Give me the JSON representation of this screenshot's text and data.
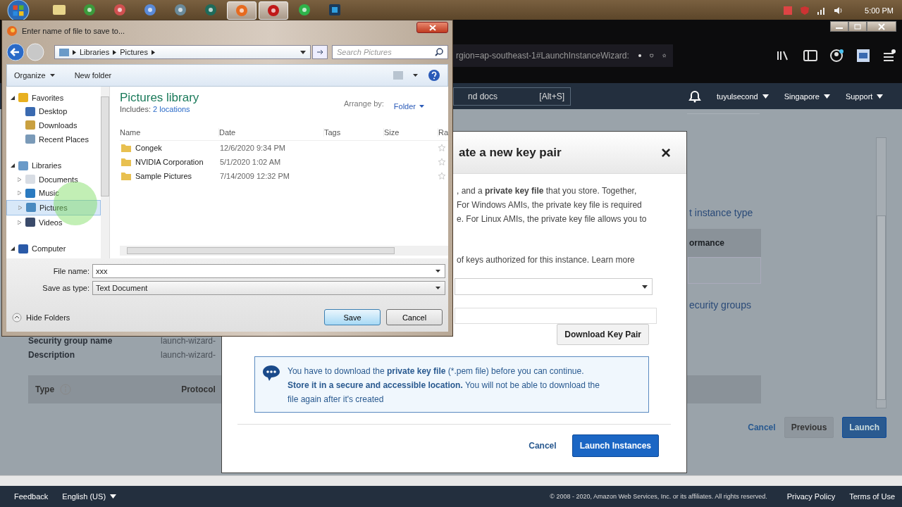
{
  "taskbar": {
    "clock": "5:00 PM",
    "apps": [
      {
        "kind": "folder",
        "selected": false
      },
      {
        "kind": "globe",
        "selected": false
      },
      {
        "kind": "music",
        "selected": false
      },
      {
        "kind": "tool",
        "selected": false
      },
      {
        "kind": "arrow",
        "selected": false
      },
      {
        "kind": "play",
        "selected": false
      },
      {
        "kind": "firefox",
        "selected": true
      },
      {
        "kind": "record",
        "selected": true
      },
      {
        "kind": "spotify",
        "selected": false
      },
      {
        "kind": "ps",
        "selected": false
      }
    ]
  },
  "browser": {
    "url": "rgion=ap-southeast-1#LaunchInstanceWizard:"
  },
  "aws_nav": {
    "search_hint": "nd docs",
    "shortcut": "[Alt+S]",
    "menus": [
      "tuyulsecond",
      "Singapore",
      "Support"
    ]
  },
  "background_page": {
    "links": [
      "t instance type",
      "ecurity groups"
    ],
    "table_header": "ormance",
    "fields": [
      {
        "label": "Security group name",
        "value": "launch-wizard-"
      },
      {
        "label": "Description",
        "value": "launch-wizard-"
      }
    ],
    "rules_header": [
      "Type",
      "Protocol"
    ],
    "cancel": "Cancel",
    "previous": "Previous",
    "launch": "Launch"
  },
  "key_pair_modal": {
    "title": "ate a new key pair",
    "close": "×",
    "intro_lines": [
      ", and a **private key file** that you store. Together,",
      "For Windows AMIs, the private key file is required",
      "e. For Linux AMIs, the private key file allows you to"
    ],
    "authorized_text": "of keys authorized for this instance. Learn more",
    "download_button": "Download Key Pair",
    "info_lines": [
      "You have to download the **private key file** (*.pem file) before you can continue.",
      "**Store it in a secure and accessible location.** You will not be able to download the",
      "file again after it's created"
    ],
    "cancel": "Cancel",
    "launch": "Launch Instances"
  },
  "save_dialog": {
    "title": "Enter name of file to save to...",
    "breadcrumb": [
      "Libraries",
      "Pictures"
    ],
    "search_placeholder": "Search Pictures",
    "toolbar": [
      "Organize",
      "New folder"
    ],
    "nav": [
      {
        "label": "Favorites",
        "kind": "star",
        "expanded": true,
        "selected": false,
        "children": [
          {
            "label": "Desktop",
            "kind": "desktop",
            "selected": false
          },
          {
            "label": "Downloads",
            "kind": "download",
            "selected": false
          },
          {
            "label": "Recent Places",
            "kind": "recent",
            "selected": false
          }
        ]
      },
      {
        "label": "Libraries",
        "kind": "library",
        "expanded": true,
        "selected": false,
        "children": [
          {
            "label": "Documents",
            "kind": "document",
            "selected": false
          },
          {
            "label": "Music",
            "kind": "music",
            "selected": false
          },
          {
            "label": "Pictures",
            "kind": "picture",
            "selected": true
          },
          {
            "label": "Videos",
            "kind": "video",
            "selected": false
          }
        ]
      },
      {
        "label": "Computer",
        "kind": "computer",
        "expanded": true,
        "selected": false
      }
    ],
    "library_title": "Pictures library",
    "includes_label": "Includes:",
    "includes_link": "2 locations",
    "arrange_label": "Arrange by:",
    "arrange_value": "Folder",
    "columns": [
      "Name",
      "Date",
      "Tags",
      "Size",
      "Ra"
    ],
    "files": [
      {
        "name": "Congek",
        "date": "12/6/2020 9:34 PM"
      },
      {
        "name": "NVIDIA Corporation",
        "date": "5/1/2020 1:02 AM"
      },
      {
        "name": "Sample Pictures",
        "date": "7/14/2009 12:32 PM"
      }
    ],
    "file_name_label": "File name:",
    "file_name": "xxx",
    "save_type_label": "Save as type:",
    "save_type": "Text Document",
    "hide_folders": "Hide Folders",
    "save": "Save",
    "cancel": "Cancel"
  },
  "footer": {
    "feedback": "Feedback",
    "language": "English (US)",
    "copyright": "© 2008 - 2020, Amazon Web Services, Inc. or its affiliates. All rights reserved.",
    "links": [
      "Privacy Policy",
      "Terms of Use"
    ]
  }
}
